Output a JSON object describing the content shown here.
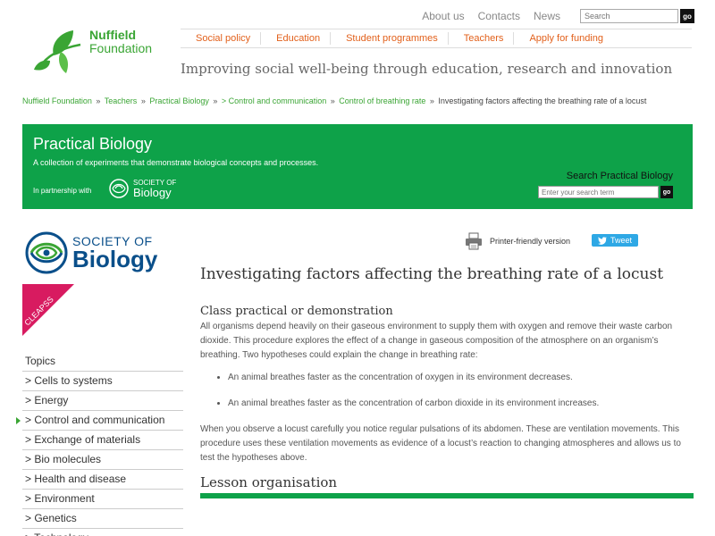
{
  "header": {
    "logo_line1": "Nuffield",
    "logo_line2": "Foundation",
    "top_links": [
      "About us",
      "Contacts",
      "News"
    ],
    "search_placeholder": "Search",
    "go_label": "go",
    "nav": [
      "Social policy",
      "Education",
      "Student programmes",
      "Teachers",
      "Apply for funding"
    ],
    "tagline": "Improving social well-being through education, research and innovation"
  },
  "breadcrumb": {
    "links": [
      "Nuffield Foundation",
      "Teachers",
      "Practical Biology",
      "> Control and communication",
      "Control of breathing rate"
    ],
    "current": "Investigating factors affecting the breathing rate of a locust",
    "separator": "»"
  },
  "banner": {
    "title": "Practical Biology",
    "subtitle": "A collection of experiments that demonstrate biological concepts and processes.",
    "partnership": "In partnership with",
    "sob_small": "SOCIETY OF",
    "sob_big": "Biology",
    "search_label": "Search Practical Biology",
    "search_placeholder": "Enter your search term",
    "go_label": "go"
  },
  "sidebar": {
    "sob_small": "SOCIETY OF",
    "sob_big": "Biology",
    "cleapss": "CLEAPSS",
    "topics_title": "Topics",
    "topics": [
      "> Cells to systems",
      "> Energy",
      "> Control and communication",
      "> Exchange of materials",
      "> Bio molecules",
      "> Health and disease",
      "> Environment",
      "> Genetics",
      "> Technology"
    ]
  },
  "tools": {
    "printer": "Printer-friendly version",
    "tweet": "Tweet"
  },
  "article": {
    "title": "Investigating factors affecting the breathing rate of a locust",
    "section1": "Class practical or demonstration",
    "intro": "All organisms depend heavily on their gaseous environment to supply them with oxygen and remove their waste carbon dioxide. This procedure explores the effect of a change in gaseous composition of the atmosphere on an organism’s breathing. Two hypotheses could explain the change in breathing rate:",
    "bullets": [
      "An animal breathes faster as the concentration of oxygen in its environment decreases.",
      "An animal breathes faster as the concentration of carbon dioxide in its environment increases."
    ],
    "para2": "When you observe a locust carefully you notice regular pulsations of its abdomen. These are ventilation movements. This procedure uses these ventilation movements as evidence of a locust’s reaction to changing atmospheres and allows us to test the hypotheses above.",
    "section2": "Lesson organisation"
  },
  "colors": {
    "brand_green": "#0ea249",
    "nav_orange": "#e2601b",
    "sob_blue": "#0a4f8a",
    "cleapss_pink": "#d81b60",
    "tweet_blue": "#2ea8e5"
  }
}
